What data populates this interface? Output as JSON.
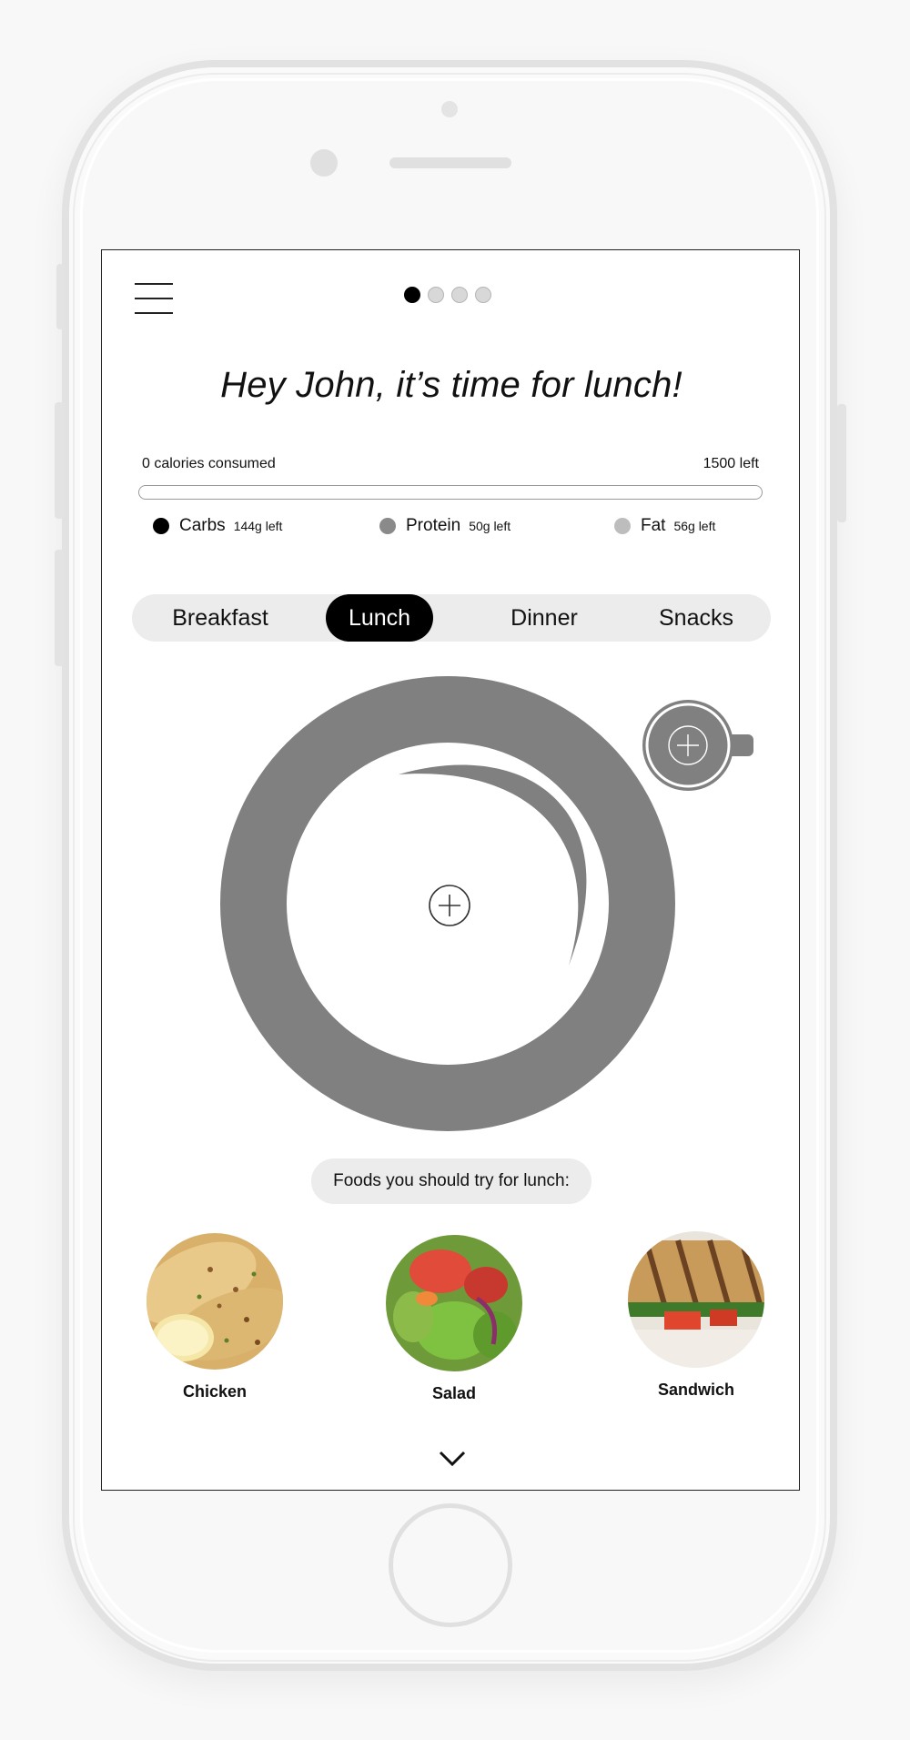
{
  "header": {
    "menu_icon": "hamburger-menu-icon",
    "pager": {
      "total": 4,
      "active_index": 0
    }
  },
  "greeting": "Hey John, it’s time for lunch!",
  "calories": {
    "consumed_label": "0 calories consumed",
    "left_label": "1500 left",
    "progress_fraction": 0.0
  },
  "macros": [
    {
      "name": "Carbs",
      "left": "144g left",
      "color": "#000000"
    },
    {
      "name": "Protein",
      "left": "50g left",
      "color": "#8a8a8a"
    },
    {
      "name": "Fat",
      "left": "56g left",
      "color": "#bdbdbd"
    }
  ],
  "meal_tabs": [
    {
      "label": "Breakfast"
    },
    {
      "label": "Lunch",
      "active": true
    },
    {
      "label": "Dinner"
    },
    {
      "label": "Snacks"
    }
  ],
  "plate": {
    "add_icon": "plus-circle-icon",
    "color": "#808080"
  },
  "cup": {
    "add_icon": "plus-circle-icon",
    "color": "#808080"
  },
  "suggestions": {
    "title": "Foods you should try for lunch:",
    "items": [
      {
        "label": "Chicken",
        "icon": "chicken-photo"
      },
      {
        "label": "Salad",
        "icon": "salad-photo"
      },
      {
        "label": "Sandwich",
        "icon": "sandwich-photo"
      }
    ]
  },
  "footer": {
    "expand_icon": "chevron-down-icon"
  }
}
